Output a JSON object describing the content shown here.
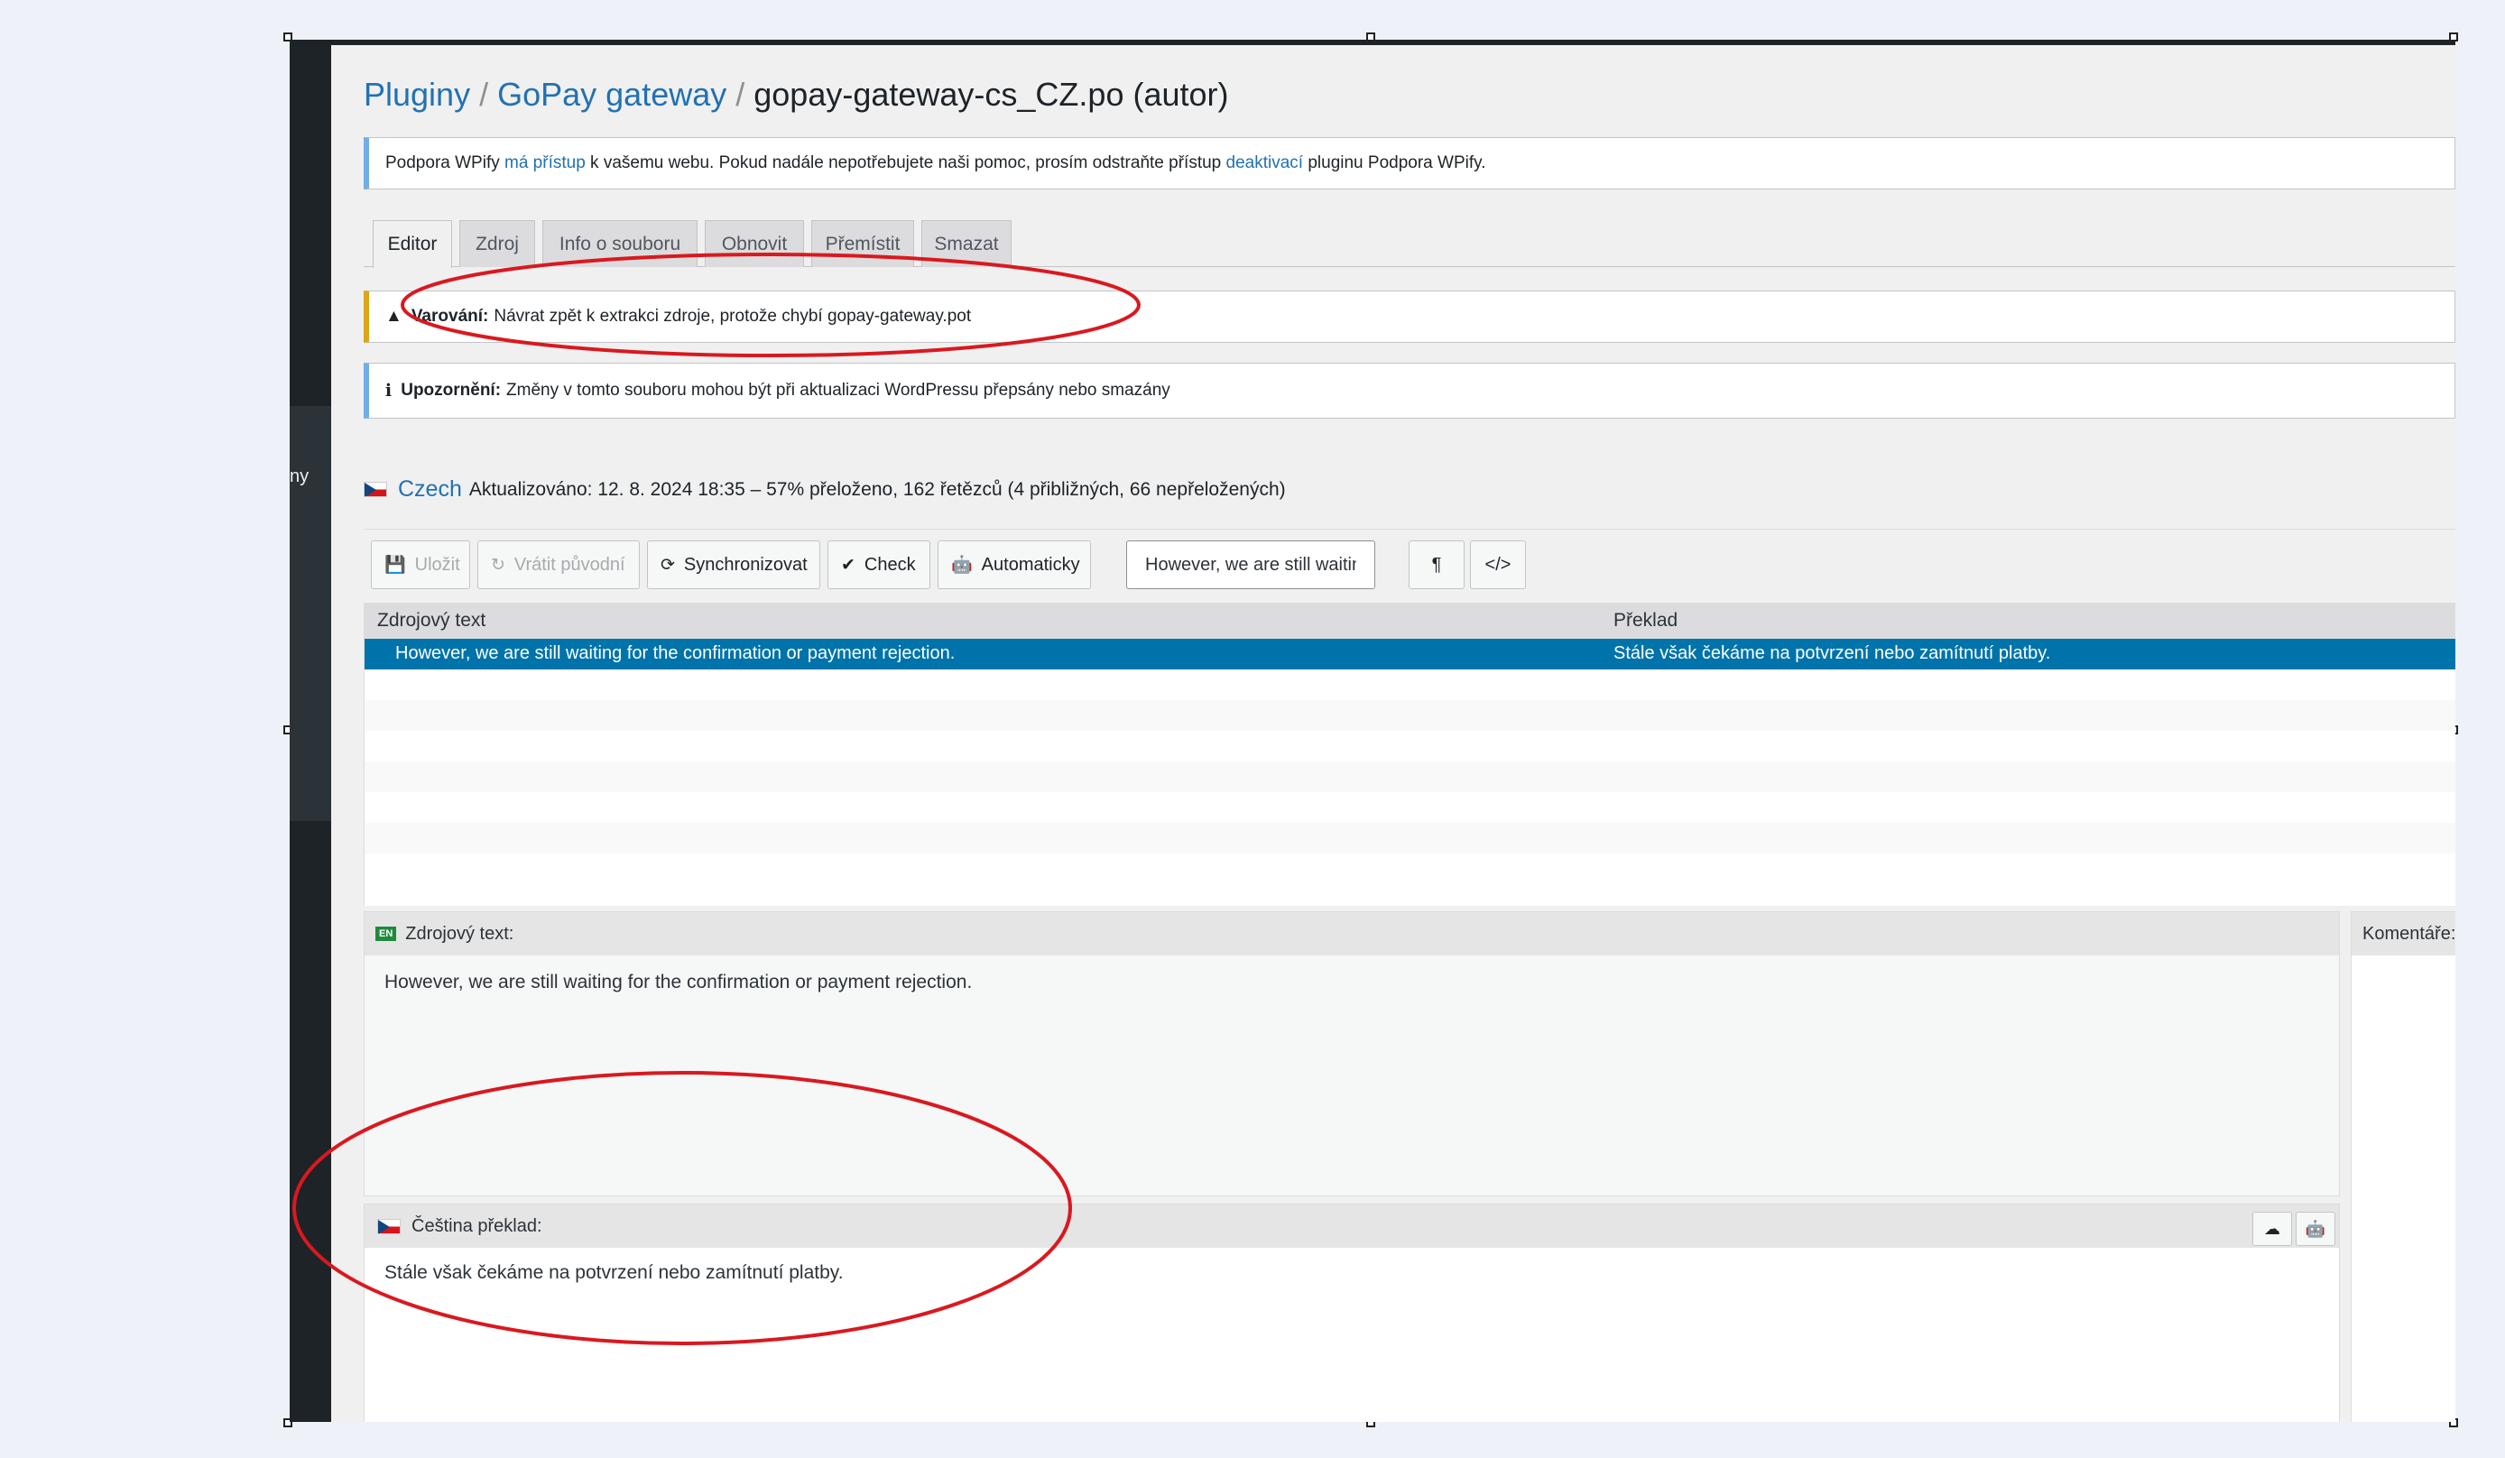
{
  "breadcrumb": {
    "plugins": "Pluginy",
    "sep1": "/",
    "plugin": "GoPay gateway",
    "sep2": "/",
    "file": "gopay-gateway-cs_CZ.po (autor)"
  },
  "sidebar": {
    "partial_label": "ny"
  },
  "support_notice": {
    "before": "Podpora WPify ",
    "link1": "má přístup",
    "middle": " k vašemu webu. Pokud nadále nepotřebujete naši pomoc, prosím odstraňte přístup ",
    "link2": "deaktivací",
    "after": " pluginu Podpora WPify."
  },
  "tabs": [
    {
      "label": "Editor"
    },
    {
      "label": "Zdroj"
    },
    {
      "label": "Info o souboru"
    },
    {
      "label": "Obnovit"
    },
    {
      "label": "Přemístit"
    },
    {
      "label": "Smazat"
    }
  ],
  "warning_notice": {
    "label": "Varování:",
    "text": "Návrat zpět k extrakci zdroje, protože chybí gopay-gateway.pot"
  },
  "info_notice": {
    "label": "Upozornění:",
    "text": "Změny v tomto souboru mohou být při aktualizaci WordPressu přepsány nebo smazány"
  },
  "language": {
    "name": "Czech",
    "status": "Aktualizováno: 12. 8. 2024 18:35 – 57% přeloženo, 162 řetězců (4 přibližných, 66 nepřeložených)"
  },
  "toolbar": {
    "save": "Uložit",
    "revert": "Vrátit původní",
    "sync": "Synchronizovat",
    "check": "Check",
    "auto": "Automaticky",
    "search_value": "However, we are still waiting for the confirmation or payment rejection."
  },
  "grid": {
    "col_source": "Zdrojový text",
    "col_translation": "Překlad",
    "rows": [
      {
        "source": "However, we are still waiting for the confirmation or payment rejection.",
        "translation": "Stále však čekáme na potvrzení nebo zamítnutí platby."
      }
    ]
  },
  "source_pane": {
    "badge": "EN",
    "label": "Zdrojový text:",
    "text": "However, we are still waiting for the confirmation or payment rejection."
  },
  "target_pane": {
    "label": "Čeština překlad:",
    "text": "Stále však čekáme na potvrzení nebo zamítnutí platby."
  },
  "comments_pane": {
    "label": "Komentáře:"
  },
  "colors": {
    "link": "#2271b1",
    "selected_row": "#0073aa",
    "warning_border": "#dba617",
    "info_border": "#72aee6",
    "annotation": "#d9191f"
  }
}
